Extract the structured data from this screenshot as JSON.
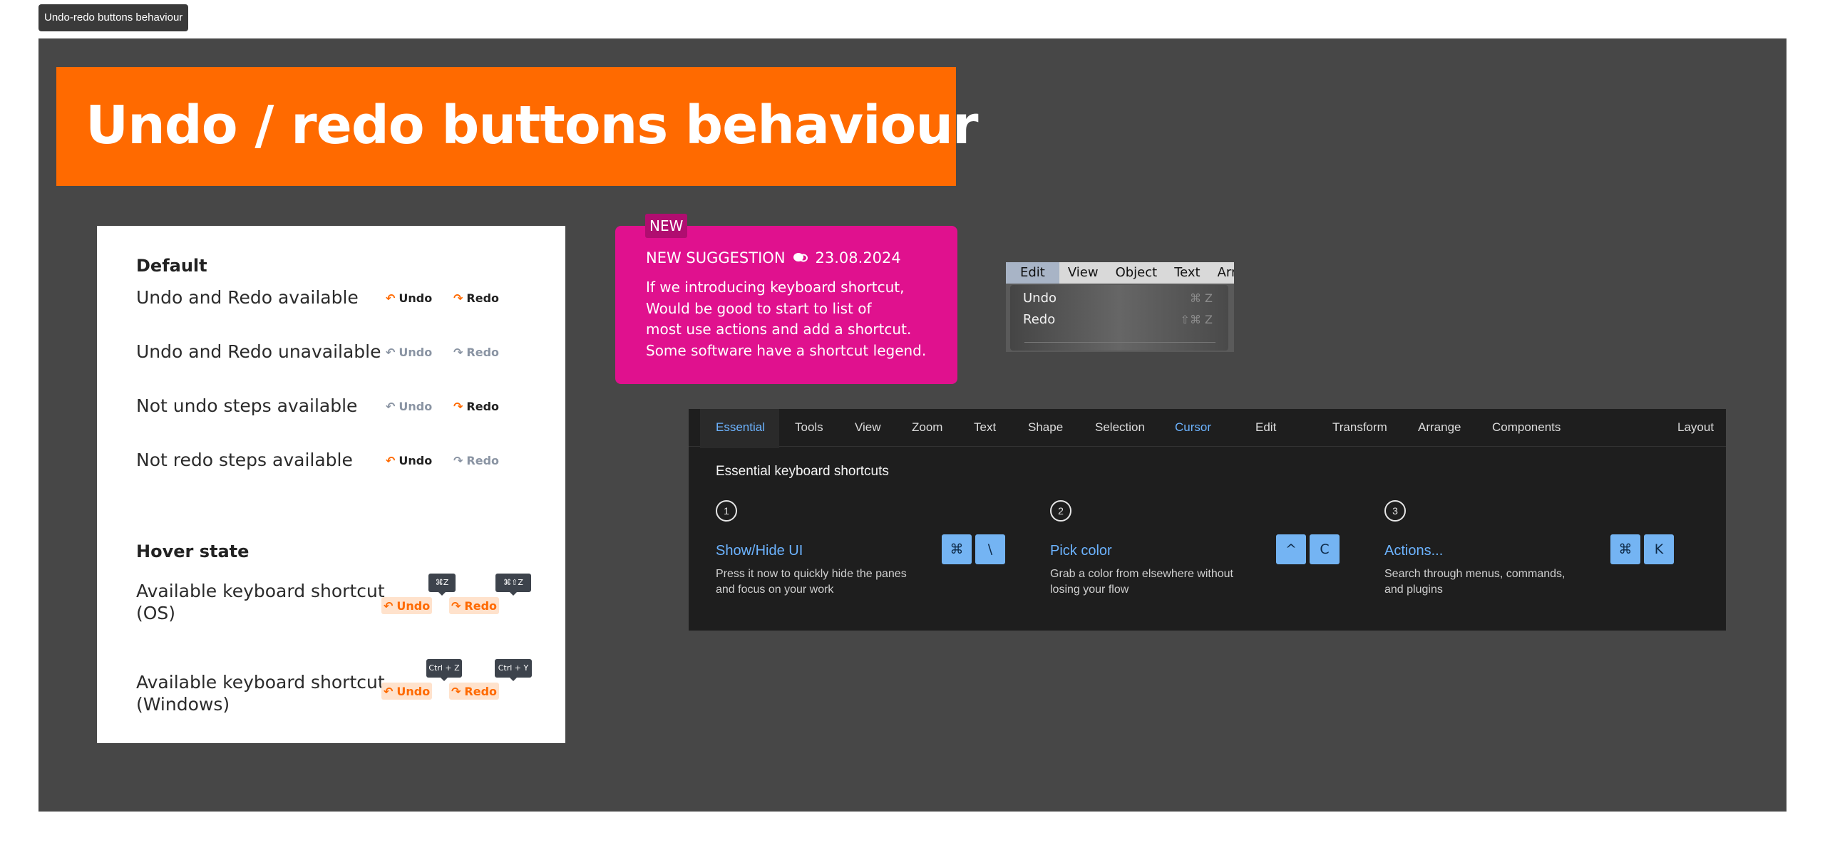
{
  "frame_label": "Undo-redo buttons behaviour",
  "banner_title": "Undo / redo buttons behaviour",
  "colors": {
    "accent": "#ff6a00",
    "suggestion": "#e0118e",
    "board": "#474747",
    "panel": "#1e1e1e",
    "link_blue": "#6cb3ff",
    "key_blue": "#74b4f3"
  },
  "icons": {
    "undo": "undo-arrow-icon",
    "redo": "redo-arrow-icon",
    "comment": "chat-bubbles-icon"
  },
  "states": {
    "default_heading": "Default",
    "hover_heading": "Hover state",
    "rows": [
      {
        "label": "Undo and Redo available",
        "undo": "Undo",
        "redo": "Redo"
      },
      {
        "label": "Undo and Redo unavailable",
        "undo": "Undo",
        "redo": "Redo"
      },
      {
        "label": "Not undo steps available",
        "undo": "Undo",
        "redo": "Redo"
      },
      {
        "label": "Not redo steps available",
        "undo": "Undo",
        "redo": "Redo"
      }
    ],
    "hover_rows": [
      {
        "label_line1": "Available keyboard shortcut",
        "label_line2": "(OS)",
        "undo_tip": "⌘Z",
        "redo_tip": "⌘⇧Z",
        "undo": "Undo",
        "redo": "Redo"
      },
      {
        "label_line1": "Available keyboard shortcut",
        "label_line2": "(Windows)",
        "undo_tip": "Ctrl + Z",
        "redo_tip": "Ctrl + Y",
        "undo": "Undo",
        "redo": "Redo"
      }
    ]
  },
  "suggestion": {
    "tag": "NEW",
    "title": "NEW SUGGESTION",
    "date": "23.08.2024",
    "lines": [
      "If we introducing keyboard shortcut,",
      "Would be good to start to list of",
      "most use actions and add a shortcut.",
      "Some software have a shortcut legend."
    ]
  },
  "menu": {
    "bar": [
      "Edit",
      "View",
      "Object",
      "Text",
      "Arr"
    ],
    "items": [
      {
        "label": "Undo",
        "shortcut": "⌘ Z"
      },
      {
        "label": "Redo",
        "shortcut": "⇧⌘ Z"
      }
    ]
  },
  "shortcuts_panel": {
    "tabs": [
      "Essential",
      "Tools",
      "View",
      "Zoom",
      "Text",
      "Shape",
      "Selection",
      "Cursor",
      "Edit",
      "Transform",
      "Arrange",
      "Components",
      "Layout"
    ],
    "title": "Essential keyboard shortcuts",
    "items": [
      {
        "num": "1",
        "title": "Show/Hide UI",
        "desc": [
          "Press it now to quickly hide the panes",
          "and focus on your work"
        ],
        "keys": [
          "⌘",
          "\\"
        ]
      },
      {
        "num": "2",
        "title": "Pick color",
        "desc": [
          "Grab a color from elsewhere without",
          "losing your flow"
        ],
        "keys": [
          "^",
          "C"
        ]
      },
      {
        "num": "3",
        "title": "Actions...",
        "desc": [
          "Search through menus, commands,",
          "and plugins"
        ],
        "keys": [
          "⌘",
          "K"
        ]
      }
    ]
  }
}
